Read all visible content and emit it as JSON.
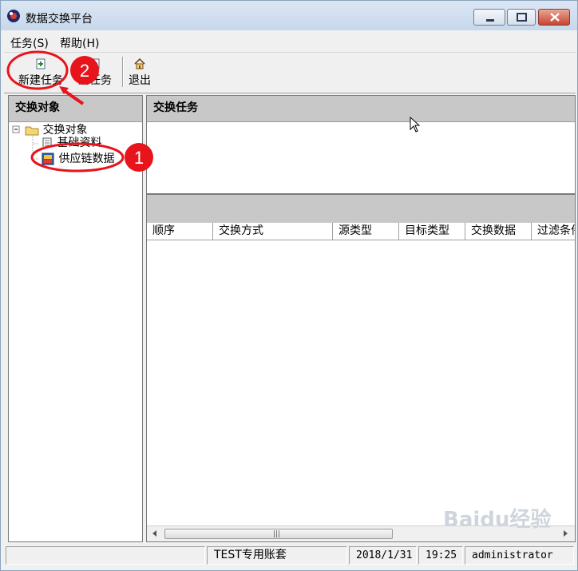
{
  "window": {
    "title": "数据交换平台"
  },
  "menu": {
    "items": [
      {
        "label": "任务(S)"
      },
      {
        "label": "帮助(H)"
      }
    ]
  },
  "toolbar": {
    "new_task": "新建任务",
    "delete_task": "删任务",
    "exit": "退出"
  },
  "left_pane": {
    "header": "交换对象",
    "tree": {
      "root": "交换对象",
      "children": [
        "基础资料",
        "供应链数据"
      ]
    }
  },
  "task_panel": {
    "header": "交换任务"
  },
  "grid": {
    "columns": [
      "顺序",
      "交换方式",
      "源类型",
      "目标类型",
      "交换数据",
      "过滤条件"
    ]
  },
  "statusbar": {
    "cells": [
      "",
      "TEST专用账套",
      "2018/1/31",
      "19:25",
      "administrator"
    ]
  },
  "annotations": {
    "circle_1": "1",
    "circle_2": "2"
  },
  "watermark": "Baidu经验",
  "colors": {
    "annotation_red": "#e8141b",
    "pane_header": "#c8c8c8"
  }
}
